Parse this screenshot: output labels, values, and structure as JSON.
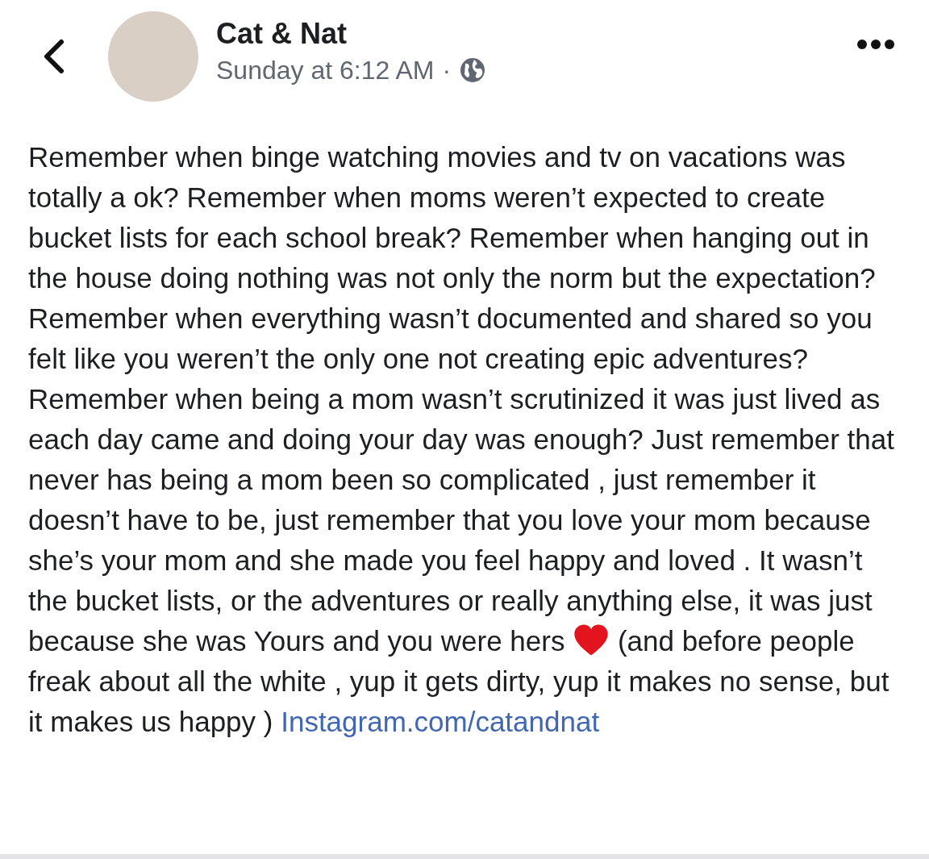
{
  "header": {
    "name": "Cat & Nat",
    "time": "Sunday at 6:12 AM",
    "separator": "·"
  },
  "post": {
    "text": "Remember when binge watching movies and tv on vacations was totally a ok? Remember when moms weren’t expected to create bucket lists for each school break? Remember when hanging out in the house doing nothing was not only the norm but the expectation? Remember when everything wasn’t documented and shared so you felt like you weren’t the only one not creating epic adventures? Remember when being a mom wasn’t scrutinized it was just lived as each day came and doing your day was enough? Just remember that never has being a mom been so complicated , just remember it doesn’t have to be, just remember that you love your mom because she’s your mom and she made you feel happy and loved . It wasn’t the bucket lists, or the adventures or really anything else, it was just because she was Yours and you were hers",
    "text_after": "(and before people freak about all the white , yup it gets dirty, yup it makes no sense, but it makes us happy )",
    "link": "Instagram.com/catandnat"
  }
}
